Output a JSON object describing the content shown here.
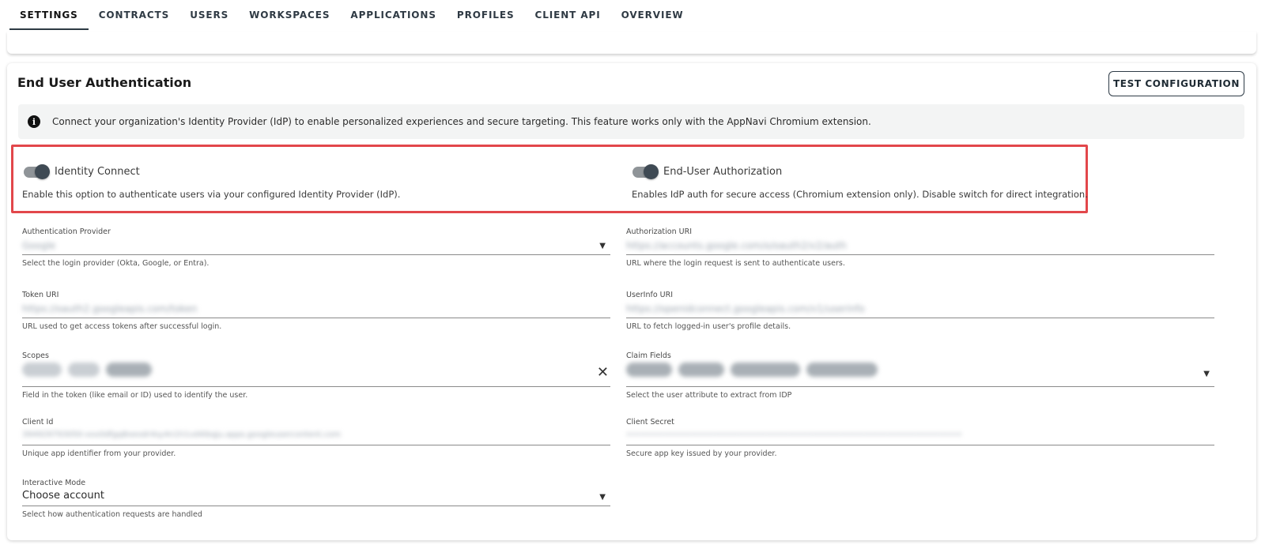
{
  "tabs": [
    "SETTINGS",
    "CONTRACTS",
    "USERS",
    "WORKSPACES",
    "APPLICATIONS",
    "PROFILES",
    "CLIENT API",
    "OVERVIEW"
  ],
  "active_tab": "SETTINGS",
  "section": {
    "title": "End User Authentication",
    "test_button": "TEST CONFIGURATION",
    "info_text": "Connect your organization's Identity Provider (IdP) to enable personalized experiences and secure targeting. This feature works only with the AppNavi Chromium extension."
  },
  "toggles": {
    "identity_connect": {
      "label": "Identity Connect",
      "description": "Enable this option to authenticate users via your configured Identity Provider (IdP).",
      "enabled": true
    },
    "end_user_authorization": {
      "label": "End-User Authorization",
      "description": "Enables IdP auth for secure access (Chromium extension only). Disable switch for direct integration.",
      "enabled": true
    }
  },
  "fields": {
    "auth_provider": {
      "label": "Authentication Provider",
      "value": "Google",
      "help": "Select the login provider (Okta, Google, or Entra)."
    },
    "authorization_uri": {
      "label": "Authorization URI",
      "value": "https://accounts.google.com/o/oauth2/v2/auth",
      "help": "URL where the login request is sent to authenticate users."
    },
    "token_uri": {
      "label": "Token URI",
      "value": "https://oauth2.googleapis.com/token",
      "help": "URL used to get access tokens after successful login."
    },
    "userinfo_uri": {
      "label": "UserInfo URI",
      "value": "https://openidconnect.googleapis.com/v1/userinfo",
      "help": "URL to fetch logged-in user's profile details."
    },
    "scopes": {
      "label": "Scopes",
      "help": "Field in the token (like email or ID) used to identify the user."
    },
    "claim_fields": {
      "label": "Claim Fields",
      "help": "Select the user attribute to extract from IDP"
    },
    "client_id": {
      "label": "Client Id",
      "value": "394929793050-xxx0dfgq8oeodr4sy4n1h1vd4ibqju.apps.googleusercontent.com",
      "help": "Unique app identifier from your provider."
    },
    "client_secret": {
      "label": "Client Secret",
      "value": "••••••••••••••••••••••••••••••••••••••••••••••••••••••••••••••••••••••••",
      "help": "Secure app key issued by your provider."
    },
    "interactive_mode": {
      "label": "Interactive Mode",
      "value": "Choose account",
      "help": "Select how authentication requests are handled"
    }
  }
}
